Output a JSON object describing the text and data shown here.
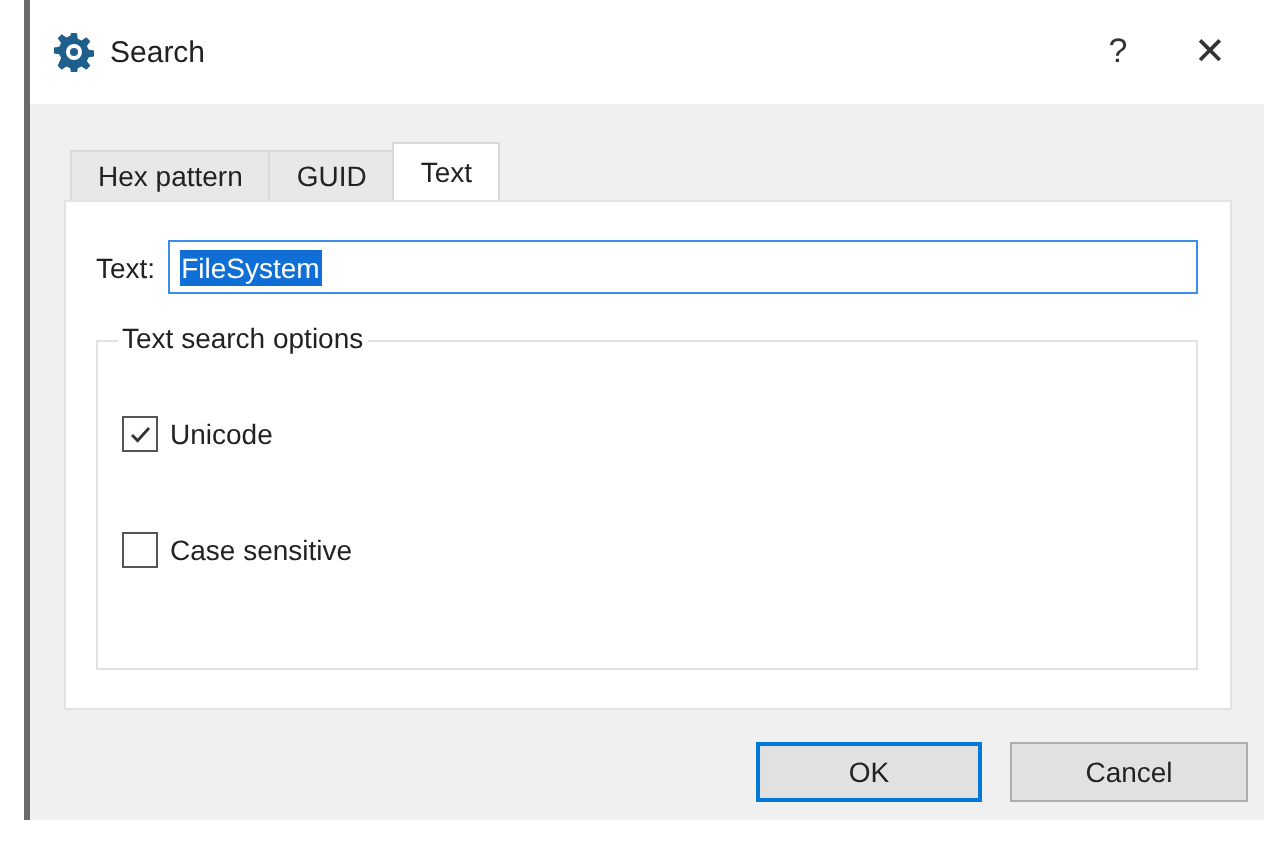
{
  "window": {
    "title": "Search",
    "help": "?",
    "close": "✕"
  },
  "tabs": [
    {
      "label": "Hex pattern",
      "selected": false
    },
    {
      "label": "GUID",
      "selected": false
    },
    {
      "label": "Text",
      "selected": true
    }
  ],
  "text_field": {
    "label": "Text:",
    "value": "FileSystem",
    "selected_all": true
  },
  "options_group": {
    "title": "Text search options",
    "options": [
      {
        "label": "Unicode",
        "checked": true
      },
      {
        "label": "Case sensitive",
        "checked": false
      }
    ]
  },
  "buttons": [
    {
      "label": "OK",
      "default": true
    },
    {
      "label": "Cancel",
      "default": false
    }
  ]
}
